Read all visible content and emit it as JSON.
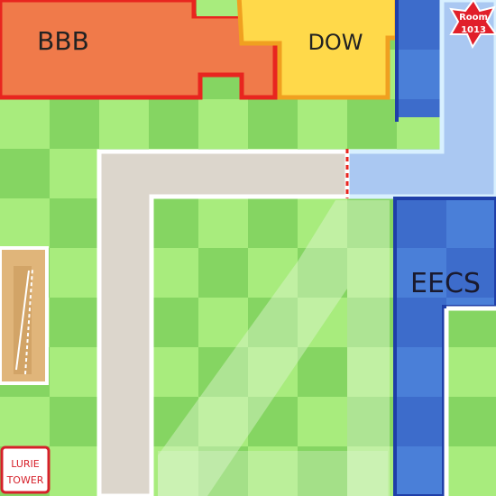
{
  "map": {
    "buildings": {
      "bbb": {
        "label": "BBB",
        "color": "#f07a4a",
        "outline": "#e8251f"
      },
      "dow": {
        "label": "DOW",
        "color": "#ffd94a",
        "outline": "#f0a020"
      },
      "eecs": {
        "label": "EECS",
        "color": "#4a7fd8",
        "outline": "#1f3fa8"
      }
    },
    "landmarks": {
      "room": {
        "line1": "Room",
        "line2": "1013",
        "color": "#e11f2a"
      },
      "lurie_tower": {
        "line1": "LURIE",
        "line2": "TOWER",
        "color": "#d6202a"
      }
    },
    "colors": {
      "grass_light": "#a8ec7d",
      "grass_dark": "#7ed05a",
      "path": "#dcd6cc",
      "walkway": "#aac8f2",
      "courtyard": "#e0b57a"
    }
  }
}
